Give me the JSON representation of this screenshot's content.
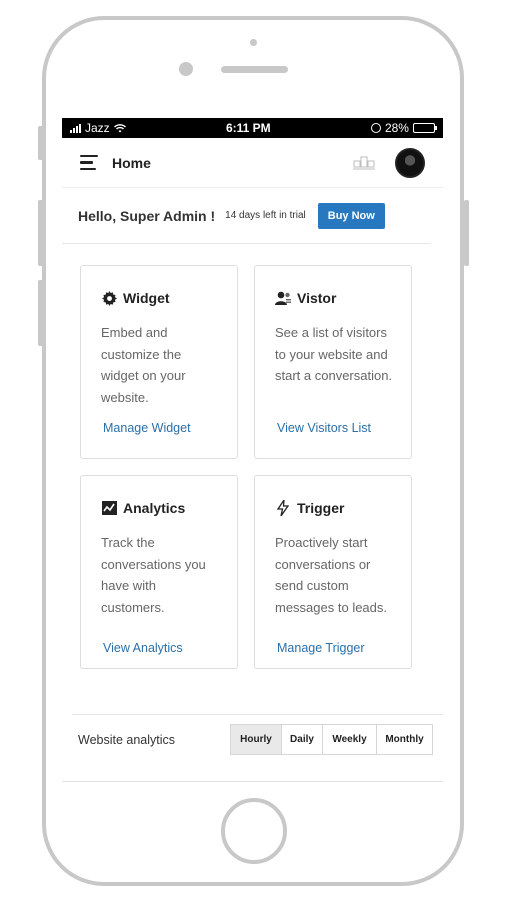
{
  "statusbar": {
    "carrier": "Jazz",
    "time": "6:11 PM",
    "battery": "28%",
    "battery_level": 0.28
  },
  "topbar": {
    "title": "Home"
  },
  "greeting": {
    "hello": "Hello, Super Admin !",
    "trial": "14 days left in trial",
    "buy_label": "Buy Now"
  },
  "cards": [
    {
      "title": "Widget",
      "icon": "gear-icon",
      "desc": "Embed and customize the widget on your website.",
      "link": "Manage Widget"
    },
    {
      "title": "Vistor",
      "icon": "visitors-icon",
      "desc": "See a list of visitors to your website and start a conversation.",
      "link": "View Visitors List"
    },
    {
      "title": "Analytics",
      "icon": "analytics-icon",
      "desc": "Track the conversations you have with customers.",
      "link": "View Analytics"
    },
    {
      "title": "Trigger",
      "icon": "lightning-icon",
      "desc": "Proactively start conversations or send custom messages to leads.",
      "link": "Manage Trigger"
    }
  ],
  "analytics": {
    "label": "Website analytics",
    "tabs": [
      "Hourly",
      "Daily",
      "Weekly",
      "Monthly"
    ],
    "selected": "Hourly"
  },
  "colors": {
    "accent": "#2878c0",
    "link": "#2a6fa8",
    "battery": "#f4c20d"
  }
}
